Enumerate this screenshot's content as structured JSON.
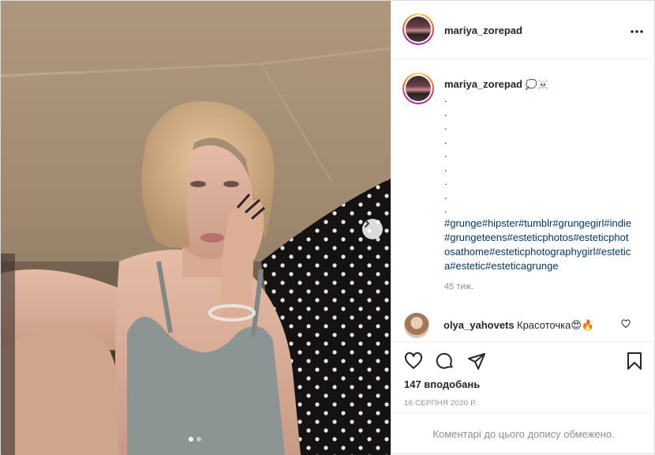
{
  "post": {
    "username": "mariya_zorepad",
    "more_label": "•••",
    "caption": {
      "emojis": "💭☠️",
      "dots": [
        ".",
        ".",
        ".",
        ".",
        ".",
        ".",
        ".",
        ".",
        "."
      ],
      "hashtags": "#grunge#hipster#tumblr#grungegirl#indie#grungeteens#esteticphotos#esteticphotosathome#esteticphotographygirl#estetica#estetic#esteticagrunge"
    },
    "time_ago": "45 тиж."
  },
  "comment": {
    "username": "olya_yahovets",
    "text": "Красоточка😍🔥"
  },
  "stats": {
    "likes": "147 вподобань",
    "date": "16 СЕРПНЯ 2020 Р."
  },
  "footer": {
    "comments_notice": "Коментарі до цього допису обмежено."
  },
  "carousel": {
    "slides": 2,
    "active": 0
  },
  "colors": {
    "hashtag": "#00376b",
    "muted": "#8e8e8e",
    "text": "#262626",
    "border": "#dbdbdb"
  },
  "icons": [
    "more-icon",
    "chat-bubble-icon",
    "skull-icon",
    "heart-icon",
    "comment-icon",
    "share-icon",
    "bookmark-icon",
    "chevron-right-icon"
  ]
}
